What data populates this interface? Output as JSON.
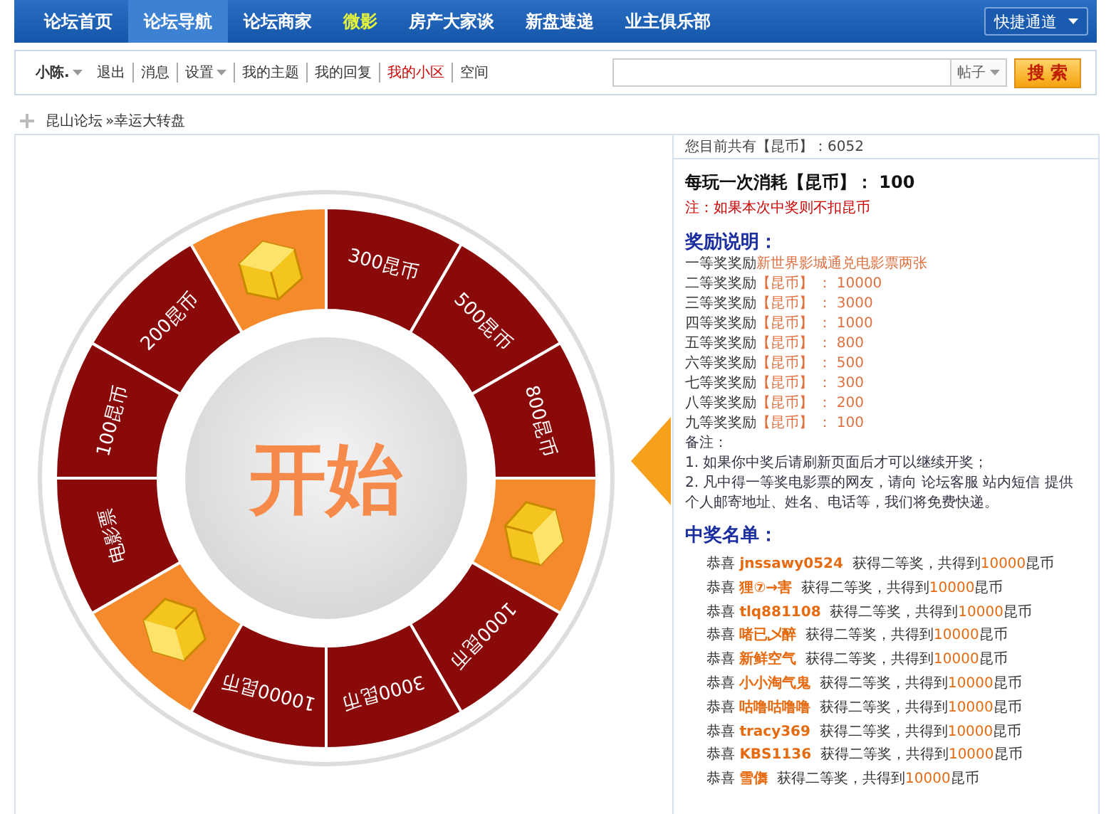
{
  "nav": {
    "items": [
      {
        "label": "论坛首页",
        "selected": false,
        "highlighted": false
      },
      {
        "label": "论坛导航",
        "selected": true,
        "highlighted": false
      },
      {
        "label": "论坛商家",
        "selected": false,
        "highlighted": false
      },
      {
        "label": "微影",
        "selected": false,
        "highlighted": true
      },
      {
        "label": "房产大家谈",
        "selected": false,
        "highlighted": false
      },
      {
        "label": "新盘速递",
        "selected": false,
        "highlighted": false
      },
      {
        "label": "业主俱乐部",
        "selected": false,
        "highlighted": false
      }
    ],
    "quick_menu": "快捷通道"
  },
  "userbar": {
    "links": [
      {
        "label": "小陈.",
        "kind": "user",
        "dropdown": true,
        "selected": false
      },
      {
        "label": "退出",
        "kind": "link",
        "dropdown": false,
        "selected": false
      },
      {
        "label": "消息",
        "kind": "link",
        "dropdown": false,
        "selected": false
      },
      {
        "label": "设置",
        "kind": "link",
        "dropdown": true,
        "selected": false
      },
      {
        "label": "我的主题",
        "kind": "link",
        "dropdown": false,
        "selected": false
      },
      {
        "label": "我的回复",
        "kind": "link",
        "dropdown": false,
        "selected": false
      },
      {
        "label": "我的小区",
        "kind": "link",
        "dropdown": false,
        "selected": true
      },
      {
        "label": "空间",
        "kind": "link",
        "dropdown": false,
        "selected": false
      }
    ],
    "search_scope": "帖子",
    "search_button": "搜 索"
  },
  "breadcrumb": [
    "昆山论坛",
    "»幸运大转盘"
  ],
  "wheel": {
    "start": "开始",
    "segments": [
      {
        "kind": "prize",
        "label": "300昆币"
      },
      {
        "kind": "prize",
        "label": "500昆币"
      },
      {
        "kind": "prize",
        "label": "800昆币"
      },
      {
        "kind": "box"
      },
      {
        "kind": "prize",
        "label": "1000昆币"
      },
      {
        "kind": "prize",
        "label": "3000昆币"
      },
      {
        "kind": "prize",
        "label": "10000昆币"
      },
      {
        "kind": "box"
      },
      {
        "kind": "prize",
        "label": "电影票"
      },
      {
        "kind": "prize",
        "label": "100昆币"
      },
      {
        "kind": "prize",
        "label": "200昆币"
      },
      {
        "kind": "box"
      }
    ]
  },
  "info": {
    "balance": "您目前共有【昆币】：6052",
    "cost": "每玩一次消耗【昆币】： 100",
    "note": "注：如果本次中奖则不扣昆币",
    "rewards_title": "奖励说明：",
    "rewards": [
      "一等奖奖励**新世界影城通兑电影票两张**",
      "二等奖奖励**【昆币】 ： 10000**",
      "三等奖奖励**【昆币】 ： 3000**",
      "四等奖奖励**【昆币】 ： 1000**",
      "五等奖奖励**【昆币】 ： 800**",
      "六等奖奖励**【昆币】 ： 500**",
      "七等奖奖励**【昆币】 ： 300**",
      "八等奖奖励**【昆币】 ： 200**",
      "九等奖奖励**【昆币】 ： 100**"
    ],
    "remarks": [
      "备注：",
      "1. 如果你中奖后请刷新页面后才可以继续开奖；",
      "2. 凡中得一等奖电影票的网友，请向 论坛客服 站内短信 提供个人邮寄地址、姓名、电话等，我们将免费快递。"
    ],
    "winners_title": "中奖名单：",
    "winners": [
      "恭喜 **jnssawy0524**  获得二等奖，共得到**10000**昆币",
      "恭喜 **狸⑦→害**  获得二等奖，共得到**10000**昆币",
      "恭喜 **tlq881108**  获得二等奖，共得到**10000**昆币",
      "恭喜 **啫已乄醉**  获得二等奖，共得到**10000**昆币",
      "恭喜 **新鲜空气**  获得二等奖，共得到**10000**昆币",
      "恭喜 **小小淘气鬼**  获得二等奖，共得到**10000**昆币",
      "恭喜 **咕噜咕噜噜**  获得二等奖，共得到**10000**昆币",
      "恭喜 **tracy369**  获得二等奖，共得到**10000**昆币",
      "恭喜 **KBS1136**  获得二等奖，共得到**10000**昆币",
      "恭喜 **雪儛**  获得二等奖，共得到**10000**昆币"
    ]
  }
}
